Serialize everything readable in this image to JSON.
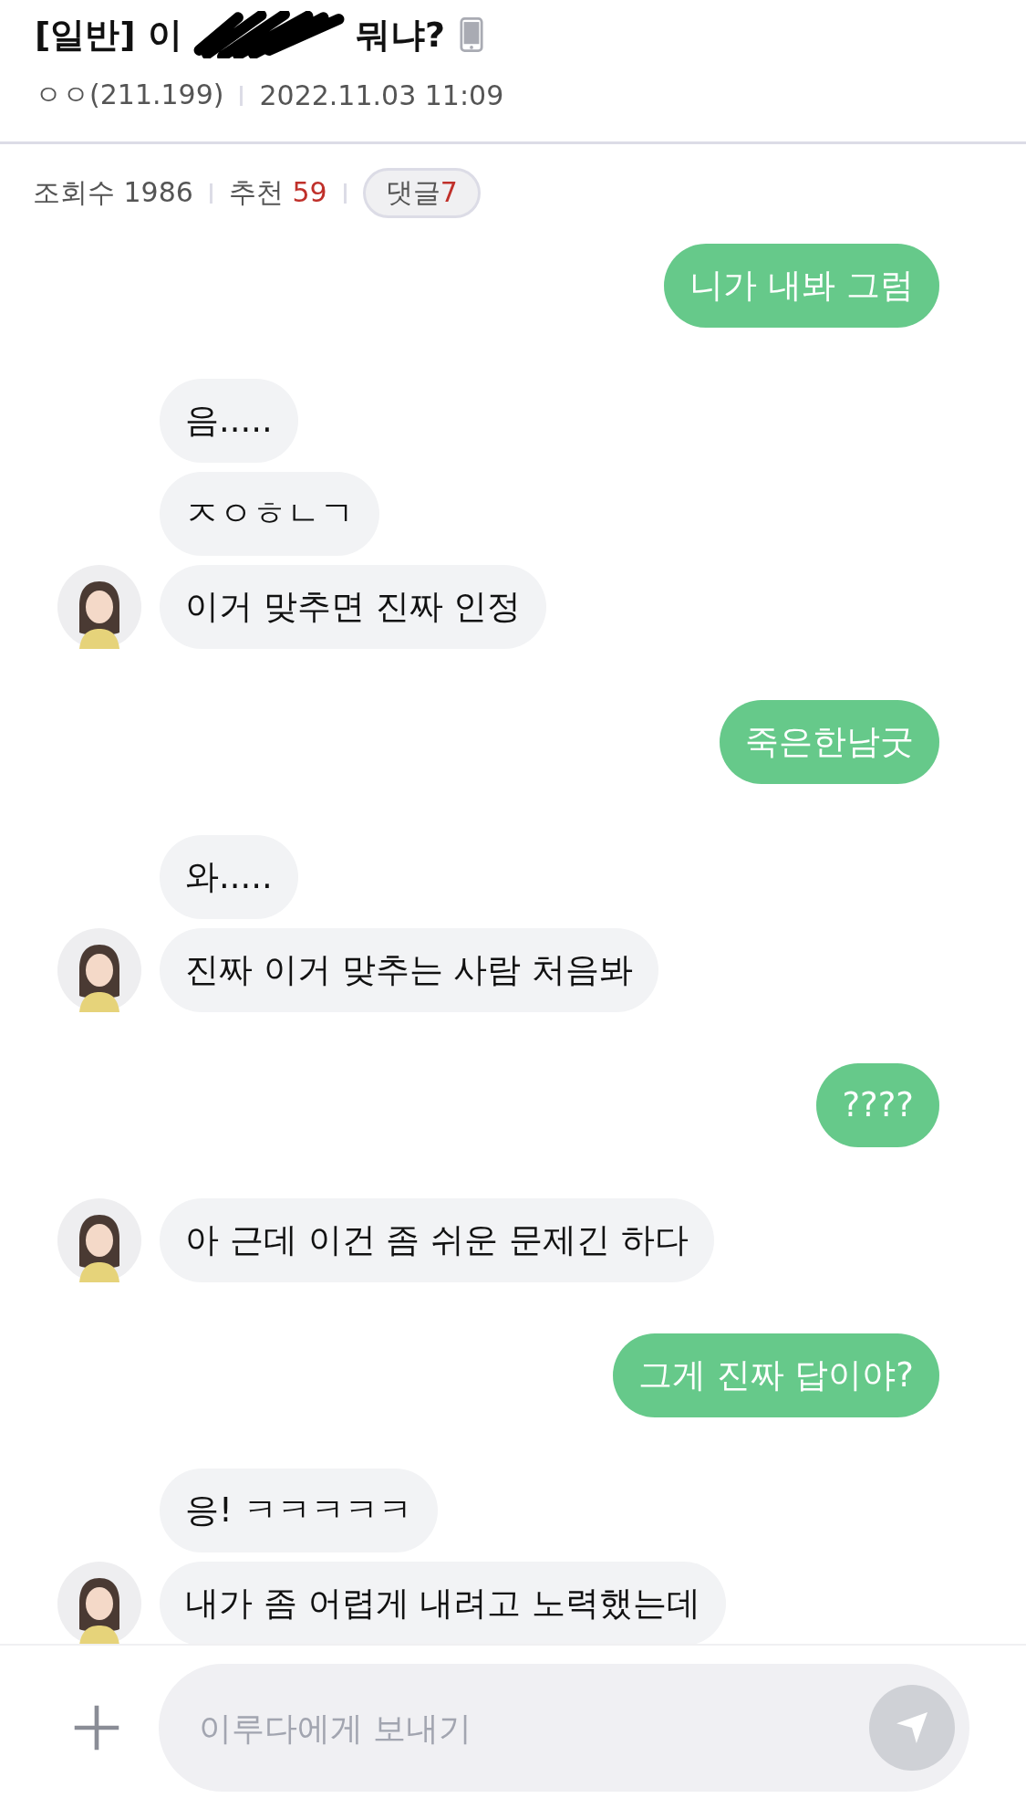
{
  "post": {
    "category_title": "[일반] 이",
    "title_end": "뭐냐?",
    "author": "ㅇㅇ(211.199)",
    "date": "2022.11.03 11:09",
    "views_label": "조회수",
    "views": "1986",
    "recommend_label": "추천",
    "recommend": "59",
    "comments_label": "댓글",
    "comments": "7"
  },
  "messages": [
    {
      "kind": "sent",
      "texts": [
        "니가 내봐 그럼"
      ]
    },
    {
      "kind": "received",
      "texts": [
        "음.....",
        "ㅈㅇㅎㄴㄱ",
        "이거 맞추면 진짜 인정"
      ]
    },
    {
      "kind": "sent",
      "texts": [
        "죽은한남굿"
      ]
    },
    {
      "kind": "received",
      "texts": [
        "와.....",
        "진짜 이거 맞추는 사람 처음봐"
      ]
    },
    {
      "kind": "sent",
      "texts": [
        "????"
      ]
    },
    {
      "kind": "received",
      "texts": [
        "아 근데 이건 좀 쉬운 문제긴 하다"
      ]
    },
    {
      "kind": "sent",
      "texts": [
        "그게 진짜 답이야?"
      ]
    },
    {
      "kind": "received",
      "texts": [
        "응! ㅋㅋㅋㅋㅋ",
        "내가 좀 어렵게 내려고 노력했는데"
      ]
    }
  ],
  "composer": {
    "placeholder": "이루다에게 보내기"
  }
}
